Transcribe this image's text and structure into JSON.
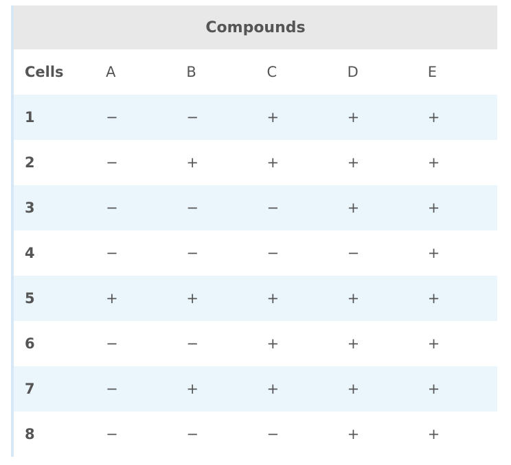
{
  "table": {
    "group_header": "Compounds",
    "columns": [
      "Cells",
      "A",
      "B",
      "C",
      "D",
      "E"
    ],
    "rows": [
      {
        "cell": "1",
        "values": [
          "−",
          "−",
          "+",
          "+",
          "+"
        ]
      },
      {
        "cell": "2",
        "values": [
          "−",
          "+",
          "+",
          "+",
          "+"
        ]
      },
      {
        "cell": "3",
        "values": [
          "−",
          "−",
          "−",
          "+",
          "+"
        ]
      },
      {
        "cell": "4",
        "values": [
          "−",
          "−",
          "−",
          "−",
          "+"
        ]
      },
      {
        "cell": "5",
        "values": [
          "+",
          "+",
          "+",
          "+",
          "+"
        ]
      },
      {
        "cell": "6",
        "values": [
          "−",
          "−",
          "+",
          "+",
          "+"
        ]
      },
      {
        "cell": "7",
        "values": [
          "−",
          "+",
          "+",
          "+",
          "+"
        ]
      },
      {
        "cell": "8",
        "values": [
          "−",
          "−",
          "−",
          "+",
          "+"
        ]
      }
    ]
  }
}
